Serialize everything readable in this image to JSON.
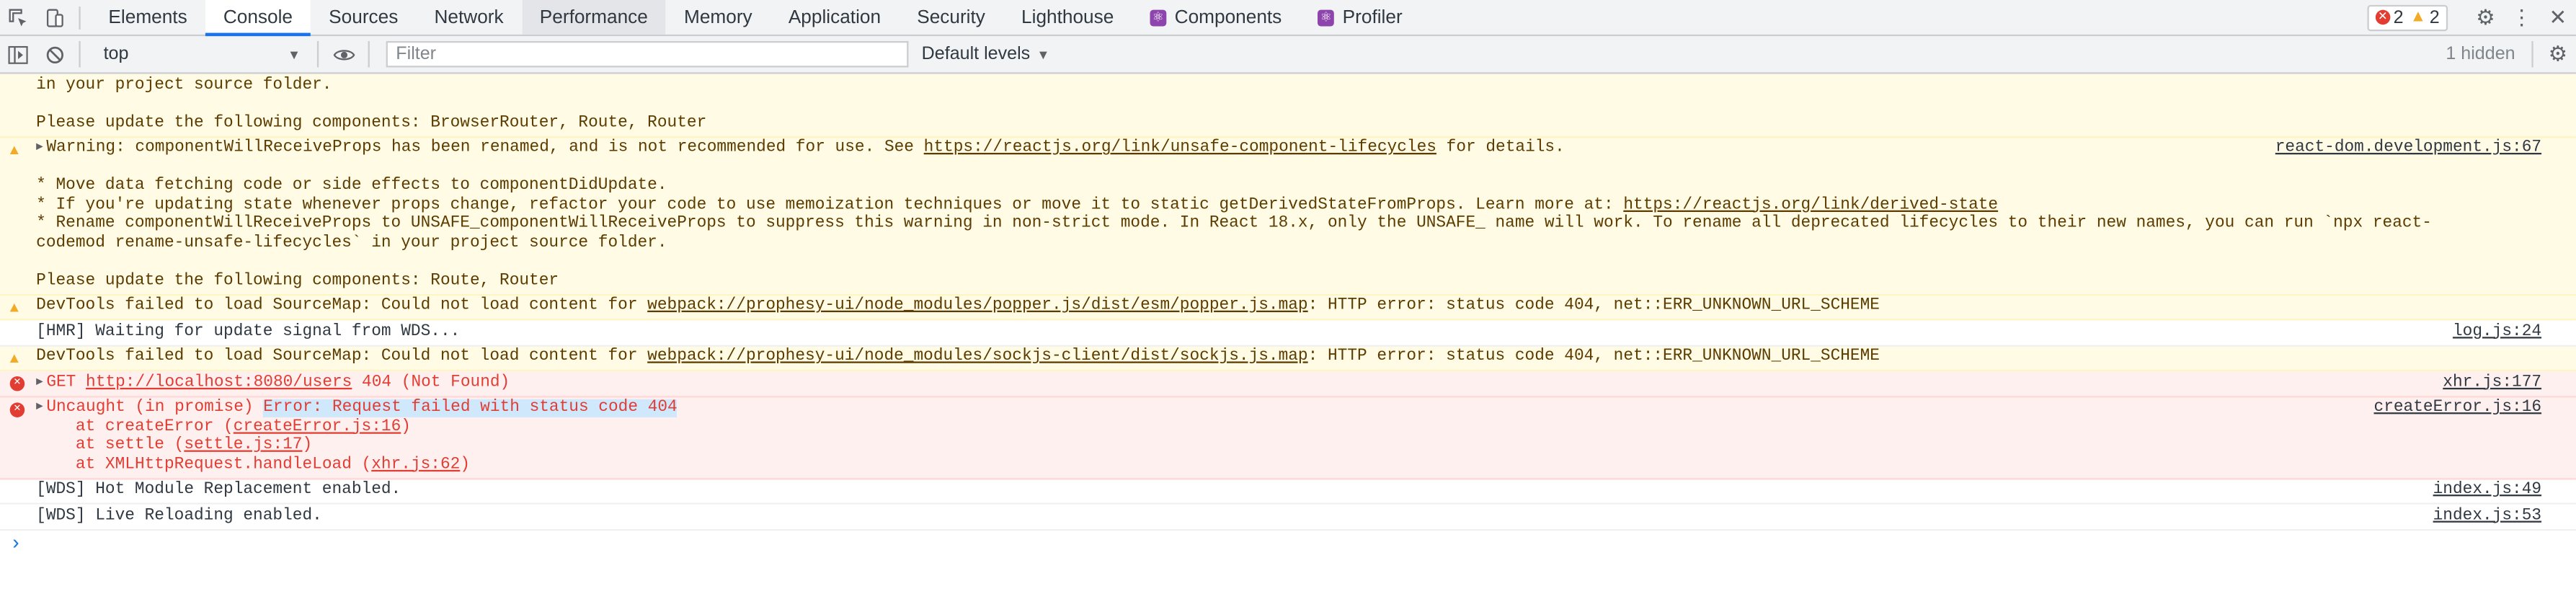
{
  "tabs": [
    {
      "label": "Elements"
    },
    {
      "label": "Console"
    },
    {
      "label": "Sources"
    },
    {
      "label": "Network"
    },
    {
      "label": "Performance"
    },
    {
      "label": "Memory"
    },
    {
      "label": "Application"
    },
    {
      "label": "Security"
    },
    {
      "label": "Lighthouse"
    },
    {
      "label": "Components"
    },
    {
      "label": "Profiler"
    }
  ],
  "counts": {
    "errors": "2",
    "warnings": "2"
  },
  "toolbar": {
    "context": "top",
    "filter_placeholder": "Filter",
    "levels": "Default levels",
    "hidden": "1 hidden"
  },
  "messages": {
    "m0_l1": "in your project source folder.",
    "m0_l2": "",
    "m0_l3": "Please update the following components: BrowserRouter, Route, Router",
    "m1_pre": "Warning: componentWillReceiveProps has been renamed, and is not recommended for use. See ",
    "m1_link": "https://reactjs.org/link/unsafe-component-lifecycles",
    "m1_post": " for details.",
    "m1_src": "react-dom.development.js:67",
    "m1_b1_pre": "* Move data fetching code or side effects to componentDidUpdate.",
    "m1_b2_pre": "* If you're updating state whenever props change, refactor your code to use memoization techniques or move it to static getDerivedStateFromProps. Learn more at: ",
    "m1_b2_link": "https://reactjs.org/link/derived-state",
    "m1_b3": "* Rename componentWillReceiveProps to UNSAFE_componentWillReceiveProps to suppress this warning in non-strict mode. In React 18.x, only the UNSAFE_ name will work. To rename all deprecated lifecycles to their new names, you can run `npx react-codemod rename-unsafe-lifecycles` in your project source folder.",
    "m1_last": "Please update the following components: Route, Router",
    "m2_pre": "DevTools failed to load SourceMap: Could not load content for ",
    "m2_link": "webpack://prophesy-ui/node_modules/popper.js/dist/esm/popper.js.map",
    "m2_post": ": HTTP error: status code 404, net::ERR_UNKNOWN_URL_SCHEME",
    "m3_text": "[HMR] Waiting for update signal from WDS...",
    "m3_src": "log.js:24",
    "m4_pre": "DevTools failed to load SourceMap: Could not load content for ",
    "m4_link": "webpack://prophesy-ui/node_modules/sockjs-client/dist/sockjs.js.map",
    "m4_post": ": HTTP error: status code 404, net::ERR_UNKNOWN_URL_SCHEME",
    "m5_pre": "GET ",
    "m5_link": "http://localhost:8080/users",
    "m5_post": " 404 (Not Found)",
    "m5_src": "xhr.js:177",
    "m6_pre": "Uncaught (in promise) ",
    "m6_hl": "Error: Request failed with status code 404",
    "m6_src": "createError.js:16",
    "m6_s1_pre": "    at createError (",
    "m6_s1_link": "createError.js:16",
    "m6_s2_pre": "    at settle (",
    "m6_s2_link": "settle.js:17",
    "m6_s3_pre": "    at XMLHttpRequest.handleLoad (",
    "m6_s3_link": "xhr.js:62",
    "close_paren": ")",
    "m7_text": "[WDS] Hot Module Replacement enabled.",
    "m7_src": "index.js:49",
    "m8_text": "[WDS] Live Reloading enabled.",
    "m8_src": "index.js:53"
  },
  "prompt": "›"
}
